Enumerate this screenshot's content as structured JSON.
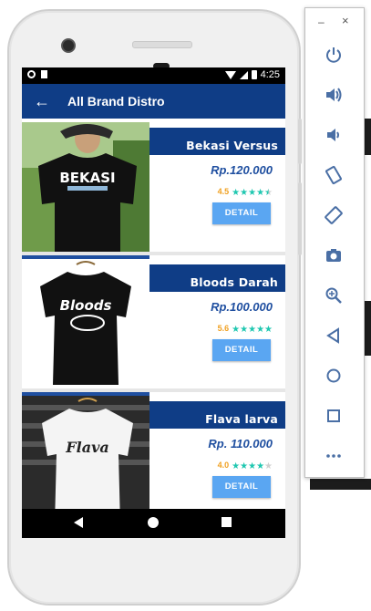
{
  "app": {
    "title": "All Brand Distro",
    "status_time": "4:25"
  },
  "products": [
    {
      "name": "Bekasi Versus",
      "price": "Rp.120.000",
      "rating": "4.5",
      "stars": 4.5,
      "button": "DETAIL",
      "shirt_text": "BEKASI",
      "shirt_color": "#111111",
      "text_color": "#ffffff"
    },
    {
      "name": "Bloods Darah",
      "price": "Rp.100.000",
      "rating": "5.6",
      "stars": 5,
      "button": "DETAIL",
      "shirt_text": "Bloods",
      "shirt_color": "#111111",
      "text_color": "#ffffff"
    },
    {
      "name": "Flava larva",
      "price": "Rp. 110.000",
      "rating": "4.0",
      "stars": 4,
      "button": "DETAIL",
      "shirt_text": "Flava",
      "shirt_color": "#f4f4f4",
      "text_color": "#222222"
    }
  ],
  "colors": {
    "primary": "#0f3d86",
    "price": "#1f4fa0",
    "button": "#5aa6f2",
    "star_on": "#1fc7b0",
    "rating_num": "#f0a020"
  },
  "toolbar": {
    "minimize": "–",
    "close": "×",
    "icons": [
      "power-icon",
      "volume-up-icon",
      "volume-down-icon",
      "rotate-left-icon",
      "rotate-right-icon",
      "camera-icon",
      "zoom-icon",
      "back-icon",
      "home-icon",
      "overview-icon",
      "more-icon"
    ]
  }
}
